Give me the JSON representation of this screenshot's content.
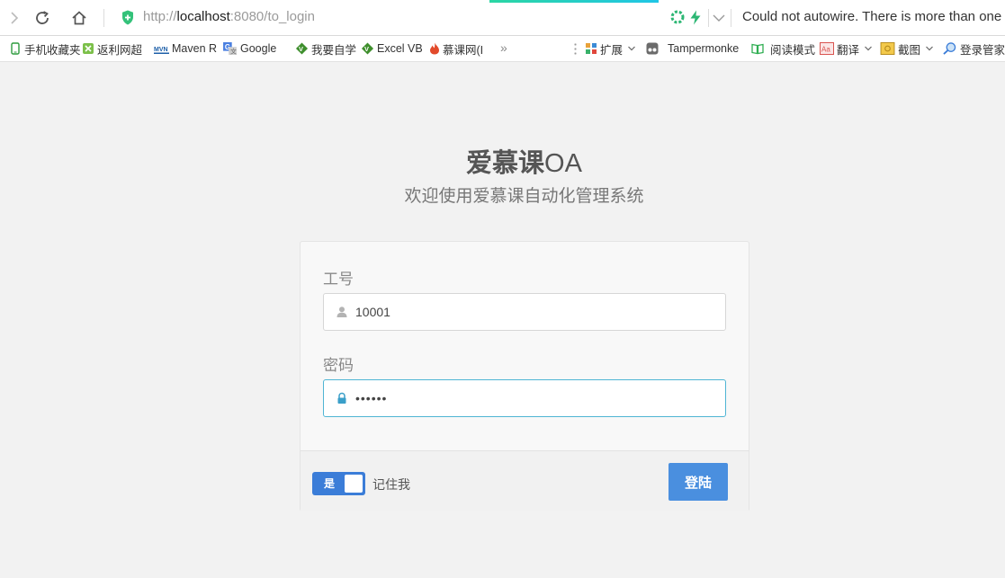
{
  "browser": {
    "url_prefix": "http://",
    "url_host": "localhost",
    "url_path": ":8080/to_login",
    "notice": "Could not autowire. There is more than one bean",
    "bookmarks": [
      {
        "label": "手机收藏夹",
        "icon": "phone-bookmark-icon",
        "color": "#2e9b3e"
      },
      {
        "label": "返利网超",
        "icon": "fanli-icon",
        "color": "#6dbb3a"
      },
      {
        "label": "Maven R",
        "icon": "mvn-icon",
        "color": "#1d5fa8"
      },
      {
        "label": "Google",
        "icon": "google-icon",
        "color": "#4a7fe0"
      },
      {
        "label": "我要自学",
        "icon": "vim-icon",
        "color": "#3f8f2d"
      },
      {
        "label": "Excel VB",
        "icon": "vim-icon",
        "color": "#3f8f2d"
      },
      {
        "label": "慕课网(I",
        "icon": "flame-icon",
        "color": "#e24a2b"
      }
    ],
    "more_chevron": "»",
    "extensions": [
      {
        "label": "扩展",
        "icon": "puzzle-icon",
        "has_arrow": true
      },
      {
        "label": "Tampermonke",
        "icon": "tampermonkey-icon",
        "has_arrow": false
      },
      {
        "label": "阅读模式",
        "icon": "book-icon",
        "has_arrow": false
      },
      {
        "label": "翻译",
        "icon": "translate-icon",
        "has_arrow": true
      },
      {
        "label": "截图",
        "icon": "screenshot-icon",
        "has_arrow": true
      },
      {
        "label": "登录管家",
        "icon": "magnifier-icon",
        "has_arrow": false
      }
    ]
  },
  "page": {
    "title_main": "爱慕课",
    "title_suffix": "OA",
    "subtitle": "欢迎使用爱慕课自动化管理系统",
    "form": {
      "username_label": "工号",
      "username_value": "10001",
      "password_label": "密码",
      "password_value": "••••••",
      "remember_toggle_text": "是",
      "remember_label": "记住我",
      "login_button": "登陆"
    }
  },
  "colors": {
    "accent": "#4a8fdf",
    "toggle": "#3b7dd8",
    "focus_border": "#4fb5d4",
    "background": "#f2f2f2"
  }
}
